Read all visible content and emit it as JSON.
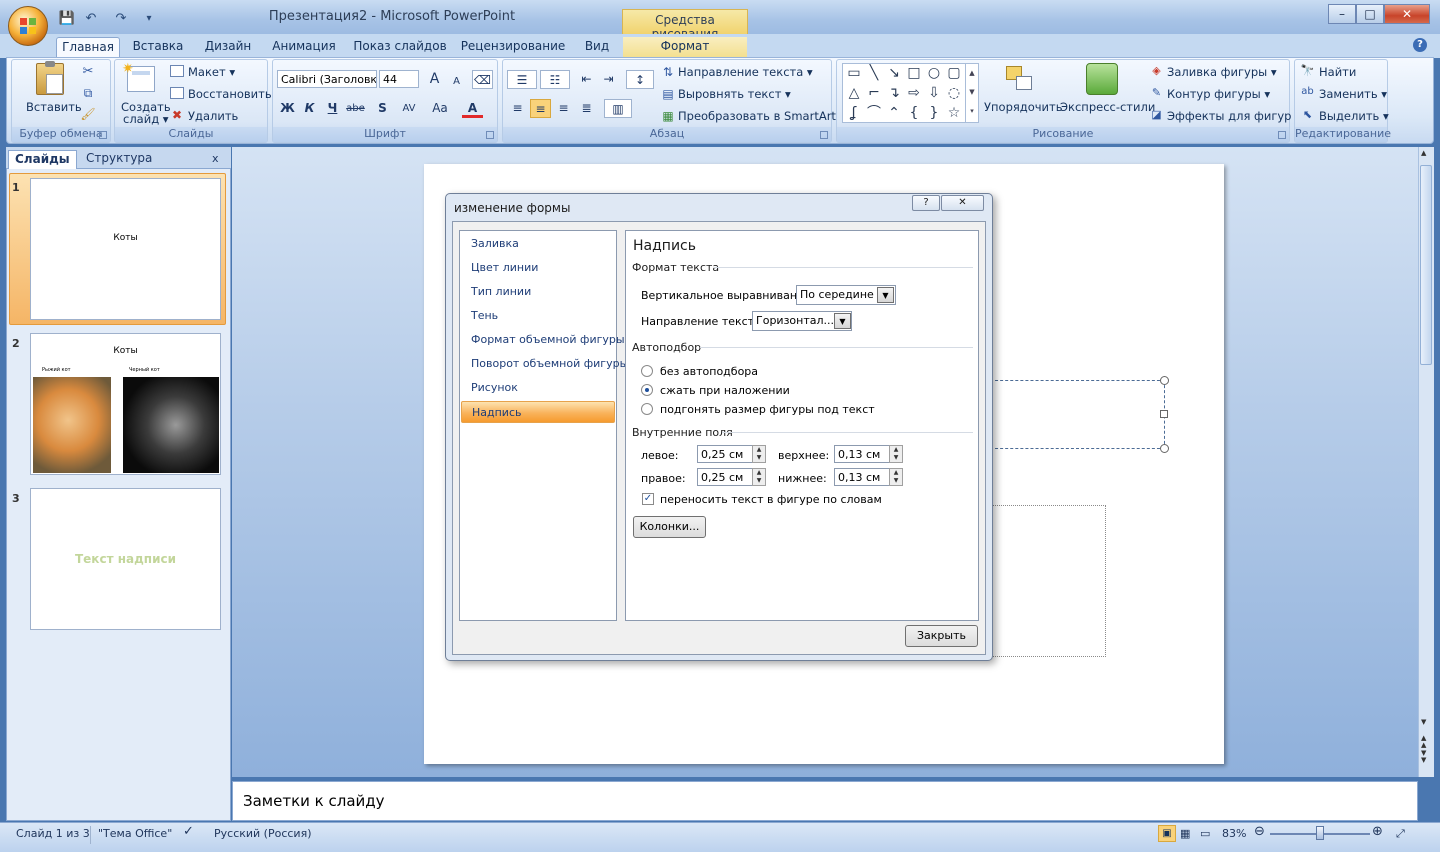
{
  "window": {
    "title": "Презентация2 - Microsoft PowerPoint",
    "context_tab_title": "Средства рисования",
    "min": "–",
    "max": "□",
    "close": "✕"
  },
  "qat": {
    "save": "💾",
    "undo": "↶",
    "redo": "↷",
    "more": "▾"
  },
  "tabs": [
    "Главная",
    "Вставка",
    "Дизайн",
    "Анимация",
    "Показ слайдов",
    "Рецензирование",
    "Вид",
    "Формат"
  ],
  "ribbon": {
    "clipboard": {
      "label": "Буфер обмена",
      "paste": "Вставить"
    },
    "slides": {
      "label": "Слайды",
      "new_slide_1": "Создать",
      "new_slide_2": "слайд ▾",
      "layout": "Макет ▾",
      "reset": "Восстановить",
      "delete": "Удалить"
    },
    "font": {
      "label": "Шрифт",
      "font_name": "Calibri (Заголовк",
      "font_size": "44",
      "bold": "Ж",
      "italic": "К",
      "underline": "Ч",
      "strike": "abe",
      "shadow": "S",
      "spacing": "AV",
      "case": "Aa",
      "grow": "A",
      "shrink": "A"
    },
    "paragraph": {
      "label": "Абзац",
      "text_direction": "Направление текста ▾",
      "align_text": "Выровнять текст ▾",
      "smartart": "Преобразовать в SmartArt ▾"
    },
    "drawing": {
      "label": "Рисование",
      "arrange": "Упорядочить",
      "quick_styles": "Экспресс-стили",
      "fill": "Заливка фигуры ▾",
      "outline": "Контур фигуры ▾",
      "effects": "Эффекты для фигур ▾"
    },
    "editing": {
      "label": "Редактирование",
      "find": "Найти",
      "replace": "Заменить ▾",
      "select": "Выделить ▾"
    }
  },
  "left_pane": {
    "tab_slides": "Слайды",
    "tab_outline": "Структура",
    "close": "x"
  },
  "thumbnails": [
    {
      "num": "1",
      "title": "Коты"
    },
    {
      "num": "2",
      "title": "Коты",
      "cap_left": "Рыжий кот",
      "cap_right": "Черный кот"
    },
    {
      "num": "3",
      "text": "Текст надписи"
    }
  ],
  "notes": {
    "placeholder": "Заметки к слайду"
  },
  "status": {
    "slide": "Слайд 1 из 3",
    "theme": "\"Тема Office\"",
    "lang": "Русский (Россия)",
    "zoom": "83%",
    "zoom_level": 0.5
  },
  "dialog": {
    "title": "изменение формы",
    "help": "?",
    "close": "✕",
    "nav": [
      "Заливка",
      "Цвет линии",
      "Тип линии",
      "Тень",
      "Формат объемной фигуры",
      "Поворот объемной фигуры",
      "Рисунок",
      "Надпись"
    ],
    "panel": {
      "heading": "Надпись",
      "text_format": "Формат текста",
      "vertical_align_label": "Вертикальное выравнивание:",
      "vertical_align_value": "По середине",
      "text_dir_label": "Направление текста:",
      "text_dir_value": "Горизонтал...",
      "autofit": "Автоподбор",
      "autofit_options": [
        "без автоподбора",
        "сжать при наложении",
        "подгонять размер фигуры под текст"
      ],
      "autofit_selected": 1,
      "margins": "Внутренние поля",
      "left_label": "левое:",
      "left_value": "0,25 см",
      "top_label": "верхнее:",
      "top_value": "0,13 см",
      "right_label": "правое:",
      "right_value": "0,25 см",
      "bottom_label": "нижнее:",
      "bottom_value": "0,13 см",
      "wrap_label": "переносить текст в фигуре по словам",
      "wrap_checked": true,
      "columns_button": "Колонки...",
      "close_button": "Закрыть"
    }
  }
}
